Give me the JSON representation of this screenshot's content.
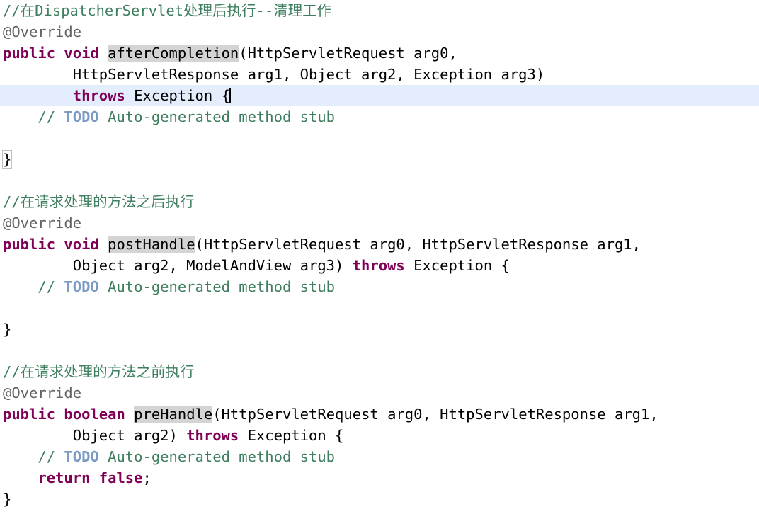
{
  "editor": {
    "language": "java",
    "theme": {
      "background": "#ffffff",
      "foreground": "#000000",
      "comment": "#3f7f5f",
      "annotation": "#646464",
      "keyword": "#7f0055",
      "todo_tag": "#7a9ac4",
      "occurrence_highlight": "#d4d4d4",
      "current_line_highlight": "#e4edfb",
      "bracket_match_outline": "#c0c0c0"
    },
    "caret_line_index": 4,
    "lines": [
      {
        "index": 0,
        "current": false,
        "tokens": [
          {
            "kind": "comment",
            "text": "//在DispatcherServlet处理后执行--清理工作"
          }
        ]
      },
      {
        "index": 1,
        "current": false,
        "tokens": [
          {
            "kind": "annot",
            "text": "@Override"
          }
        ]
      },
      {
        "index": 2,
        "current": false,
        "tokens": [
          {
            "kind": "keyword",
            "text": "public"
          },
          {
            "kind": "plain",
            "text": " "
          },
          {
            "kind": "keyword",
            "text": "void"
          },
          {
            "kind": "plain",
            "text": " "
          },
          {
            "kind": "occurrence",
            "text": "afterCompletion"
          },
          {
            "kind": "plain",
            "text": "(HttpServletRequest arg0,"
          }
        ]
      },
      {
        "index": 3,
        "current": false,
        "tokens": [
          {
            "kind": "plain",
            "text": "        HttpServletResponse arg1, Object arg2, Exception arg3)"
          }
        ]
      },
      {
        "index": 4,
        "current": true,
        "tokens": [
          {
            "kind": "plain",
            "text": "        "
          },
          {
            "kind": "keyword",
            "text": "throws"
          },
          {
            "kind": "plain",
            "text": " Exception {"
          },
          {
            "kind": "caret",
            "text": ""
          }
        ]
      },
      {
        "index": 5,
        "current": false,
        "tokens": [
          {
            "kind": "comment",
            "text": "    // "
          },
          {
            "kind": "todo",
            "text": "TODO"
          },
          {
            "kind": "comment",
            "text": " Auto-generated method stub"
          }
        ]
      },
      {
        "index": 6,
        "current": false,
        "tokens": []
      },
      {
        "index": 7,
        "current": false,
        "tokens": [
          {
            "kind": "bracket",
            "text": "}"
          }
        ]
      },
      {
        "index": 8,
        "current": false,
        "tokens": []
      },
      {
        "index": 9,
        "current": false,
        "tokens": [
          {
            "kind": "comment",
            "text": "//在请求处理的方法之后执行"
          }
        ]
      },
      {
        "index": 10,
        "current": false,
        "tokens": [
          {
            "kind": "annot",
            "text": "@Override"
          }
        ]
      },
      {
        "index": 11,
        "current": false,
        "tokens": [
          {
            "kind": "keyword",
            "text": "public"
          },
          {
            "kind": "plain",
            "text": " "
          },
          {
            "kind": "keyword",
            "text": "void"
          },
          {
            "kind": "plain",
            "text": " "
          },
          {
            "kind": "occurrence",
            "text": "postHandle"
          },
          {
            "kind": "plain",
            "text": "(HttpServletRequest arg0, HttpServletResponse arg1,"
          }
        ]
      },
      {
        "index": 12,
        "current": false,
        "tokens": [
          {
            "kind": "plain",
            "text": "        Object arg2, ModelAndView arg3) "
          },
          {
            "kind": "keyword",
            "text": "throws"
          },
          {
            "kind": "plain",
            "text": " Exception {"
          }
        ]
      },
      {
        "index": 13,
        "current": false,
        "tokens": [
          {
            "kind": "comment",
            "text": "    // "
          },
          {
            "kind": "todo",
            "text": "TODO"
          },
          {
            "kind": "comment",
            "text": " Auto-generated method stub"
          }
        ]
      },
      {
        "index": 14,
        "current": false,
        "tokens": []
      },
      {
        "index": 15,
        "current": false,
        "tokens": [
          {
            "kind": "plain",
            "text": "}"
          }
        ]
      },
      {
        "index": 16,
        "current": false,
        "tokens": []
      },
      {
        "index": 17,
        "current": false,
        "tokens": [
          {
            "kind": "comment",
            "text": "//在请求处理的方法之前执行"
          }
        ]
      },
      {
        "index": 18,
        "current": false,
        "tokens": [
          {
            "kind": "annot",
            "text": "@Override"
          }
        ]
      },
      {
        "index": 19,
        "current": false,
        "tokens": [
          {
            "kind": "keyword",
            "text": "public"
          },
          {
            "kind": "plain",
            "text": " "
          },
          {
            "kind": "keyword",
            "text": "boolean"
          },
          {
            "kind": "plain",
            "text": " "
          },
          {
            "kind": "occurrence",
            "text": "preHandle"
          },
          {
            "kind": "plain",
            "text": "(HttpServletRequest arg0, HttpServletResponse arg1,"
          }
        ]
      },
      {
        "index": 20,
        "current": false,
        "tokens": [
          {
            "kind": "plain",
            "text": "        Object arg2) "
          },
          {
            "kind": "keyword",
            "text": "throws"
          },
          {
            "kind": "plain",
            "text": " Exception {"
          }
        ]
      },
      {
        "index": 21,
        "current": false,
        "tokens": [
          {
            "kind": "comment",
            "text": "    // "
          },
          {
            "kind": "todo",
            "text": "TODO"
          },
          {
            "kind": "comment",
            "text": " Auto-generated method stub"
          }
        ]
      },
      {
        "index": 22,
        "current": false,
        "tokens": [
          {
            "kind": "plain",
            "text": "    "
          },
          {
            "kind": "keyword",
            "text": "return"
          },
          {
            "kind": "plain",
            "text": " "
          },
          {
            "kind": "keyword",
            "text": "false"
          },
          {
            "kind": "plain",
            "text": ";"
          }
        ]
      },
      {
        "index": 23,
        "current": false,
        "tokens": [
          {
            "kind": "plain",
            "text": "}"
          }
        ]
      }
    ]
  }
}
